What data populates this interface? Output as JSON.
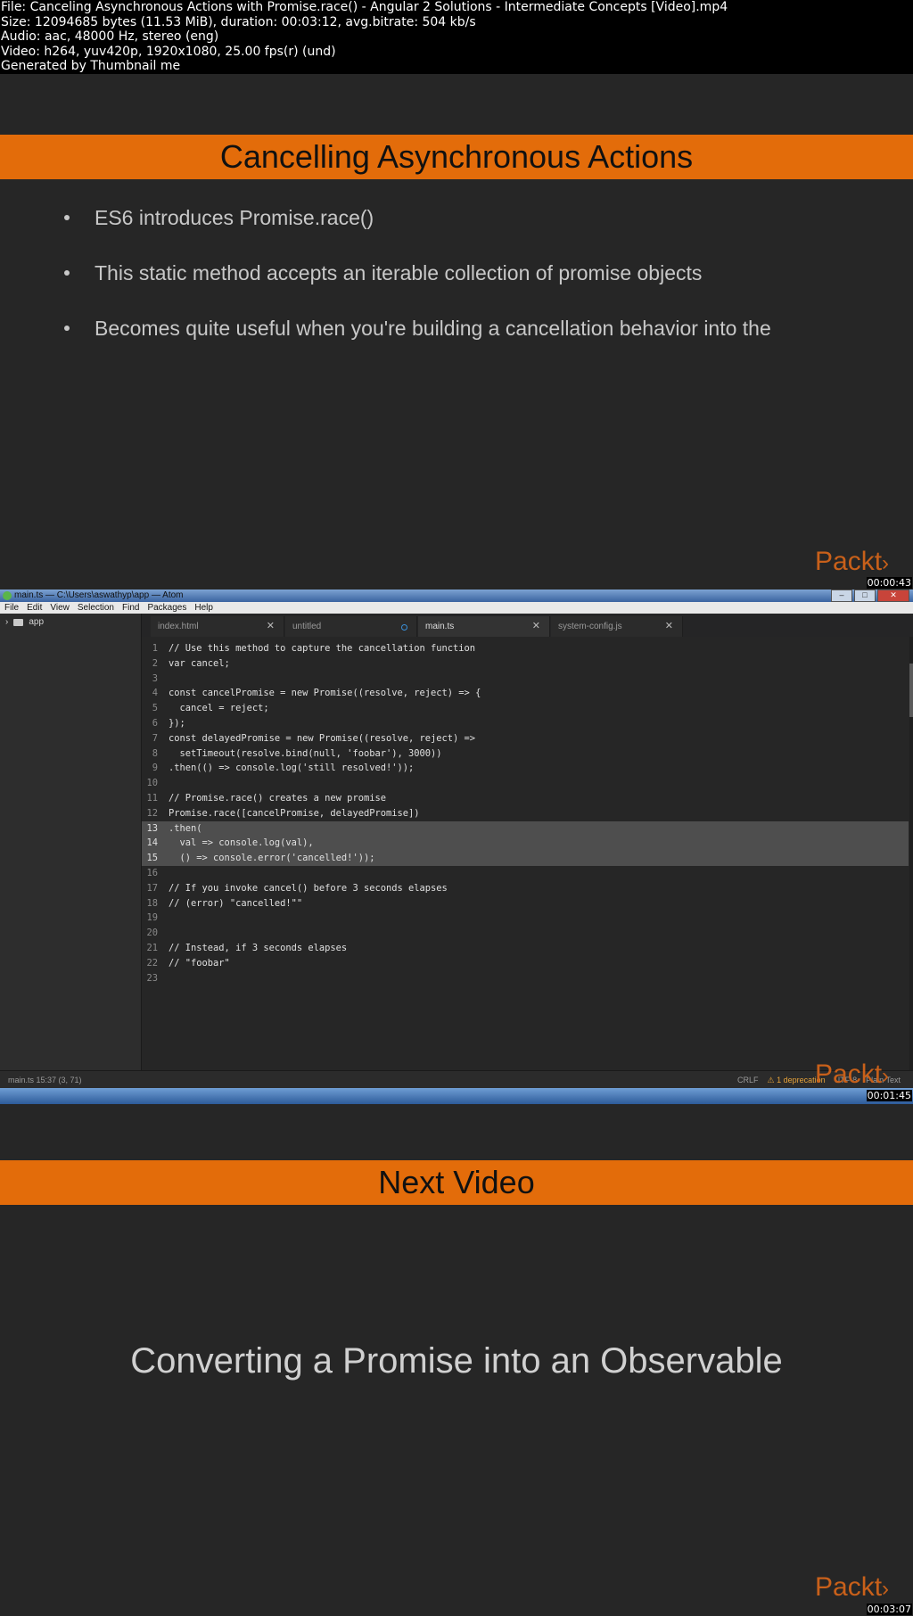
{
  "header": {
    "lines": [
      "File: Canceling Asynchronous Actions with Promise.race() - Angular 2 Solutions - Intermediate Concepts [Video].mp4",
      "Size: 12094685 bytes (11.53 MiB), duration: 00:03:12, avg.bitrate: 504 kb/s",
      "Audio: aac, 48000 Hz, stereo (eng)",
      "Video: h264, yuv420p, 1920x1080, 25.00 fps(r) (und)",
      "Generated by Thumbnail me"
    ]
  },
  "frame1": {
    "title": "Cancelling Asynchronous Actions",
    "bullets": [
      "ES6 introduces Promise.race()",
      "This static method accepts an iterable collection of promise objects",
      "Becomes quite useful when you're building a cancellation behavior into the"
    ],
    "logo": "Packt",
    "timestamp": "00:00:43"
  },
  "frame2": {
    "window_title": "main.ts — C:\\Users\\aswathyp\\app — Atom",
    "menu": [
      "File",
      "Edit",
      "View",
      "Selection",
      "Find",
      "Packages",
      "Help"
    ],
    "tree_root": "app",
    "tabs": [
      {
        "label": "index.html",
        "state": "close"
      },
      {
        "label": "untitled",
        "state": "modified"
      },
      {
        "label": "main.ts",
        "state": "close",
        "active": true
      },
      {
        "label": "system-config.js",
        "state": "close"
      }
    ],
    "code": [
      "// Use this method to capture the cancellation function",
      "var cancel;",
      "",
      "const cancelPromise = new Promise((resolve, reject) => {",
      "  cancel = reject;",
      "});",
      "const delayedPromise = new Promise((resolve, reject) =>",
      "  setTimeout(resolve.bind(null, 'foobar'), 3000))",
      ".then(() => console.log('still resolved!'));",
      "",
      "// Promise.race() creates a new promise",
      "Promise.race([cancelPromise, delayedPromise])",
      ".then(",
      "  val => console.log(val),",
      "  () => console.error('cancelled!'));",
      "",
      "// If you invoke cancel() before 3 seconds elapses",
      "// (error) \"cancelled!\"\"",
      "",
      "",
      "// Instead, if 3 seconds elapses",
      "// \"foobar\"",
      ""
    ],
    "selected_lines": [
      13,
      14,
      15
    ],
    "status_left": "main.ts   15:37   (3, 71)",
    "status_crlf": "CRLF",
    "status_warning": "1 deprecation",
    "status_encoding": "UTF-8",
    "status_grammar": "Plain Text",
    "logo": "Packt",
    "timestamp": "00:01:45"
  },
  "frame3": {
    "title": "Next Video",
    "subtitle": "Converting a Promise into an Observable",
    "logo": "Packt",
    "timestamp": "00:03:07"
  }
}
